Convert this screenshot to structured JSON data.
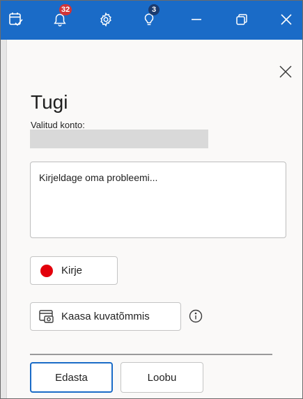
{
  "titlebar": {
    "accent_color": "#1a6bc7",
    "icons": [
      {
        "name": "calendar-check-icon"
      },
      {
        "name": "bell-icon",
        "badge": "32"
      },
      {
        "name": "gear-icon"
      },
      {
        "name": "lightbulb-icon",
        "badge": "3"
      },
      {
        "name": "minimize-icon"
      },
      {
        "name": "restore-icon"
      },
      {
        "name": "close-icon"
      }
    ]
  },
  "panel": {
    "title": "Tugi",
    "account_label": "Valitud konto:",
    "account_value": "",
    "description_placeholder": "Kirjeldage oma probleemi...",
    "record_label": "Kirje",
    "record_color": "#e3000b",
    "screenshot_label": "Kaasa kuvatõmmis",
    "submit_label": "Edasta",
    "cancel_label": "Loobu"
  }
}
